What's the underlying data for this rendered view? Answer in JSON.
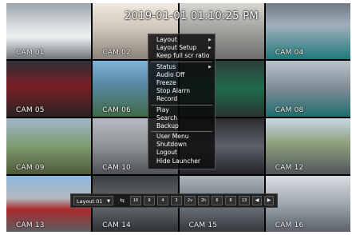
{
  "timestamp": "2019-01-01 01:10:25 PM",
  "cameras": [
    {
      "label": "CAM 01"
    },
    {
      "label": "CAM 02"
    },
    {
      "label": "CAM 04"
    },
    {
      "label": ""
    },
    {
      "label": "CAM 05"
    },
    {
      "label": "CAM 06"
    },
    {
      "label": ""
    },
    {
      "label": "CAM 08"
    },
    {
      "label": "CAM 09"
    },
    {
      "label": "CAM 10"
    },
    {
      "label": ""
    },
    {
      "label": "CAM 12"
    },
    {
      "label": "CAM 13"
    },
    {
      "label": "CAM 14"
    },
    {
      "label": "CAM 15"
    },
    {
      "label": "CAM 16"
    }
  ],
  "context_menu": {
    "items": [
      "Layout",
      "Layout Setup",
      "Keep full scr ratio",
      "Status",
      "Audio Off",
      "Freeze",
      "Stop Alarm",
      "Record",
      "Play",
      "Search",
      "Backup",
      "User Menu",
      "Shutdown",
      "Logout",
      "Hide Launcher"
    ],
    "submenu_arrow": "▶"
  },
  "launcher": {
    "layout_value": "Layout 01",
    "caret": "▼",
    "sequence_icon": "⇆",
    "split_buttons": [
      "16",
      "9",
      "4",
      "3",
      "2v",
      "2h",
      "6",
      "8",
      "13"
    ],
    "prev_icon": "◀",
    "next_icon": "▶"
  }
}
